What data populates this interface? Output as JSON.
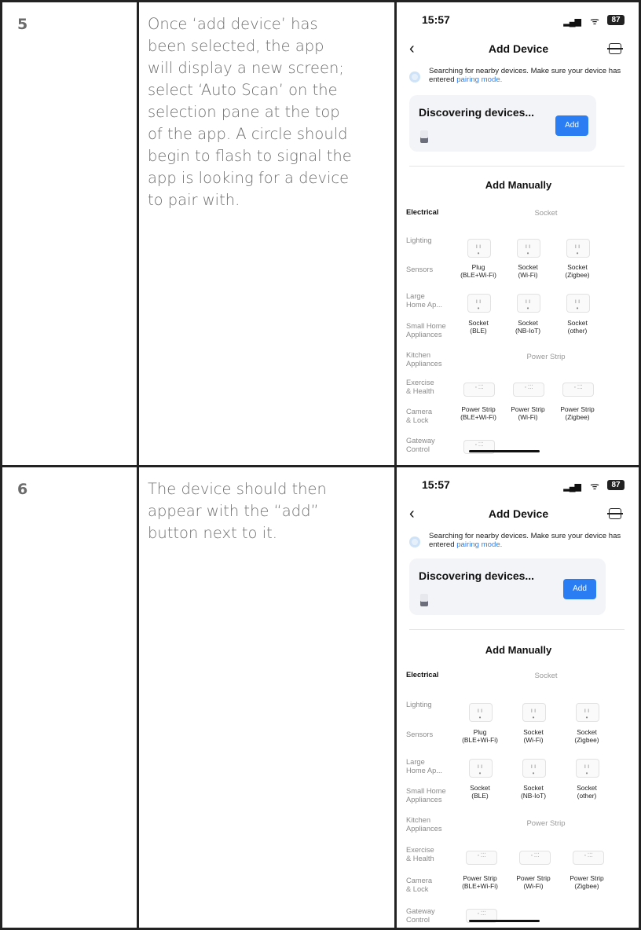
{
  "steps": [
    {
      "number": "5",
      "description": "Once ‘add device’ has\nbeen selected, the app\nwill display a new screen;\nselect ‘Auto Scan’ on the\nselection pane at the top\nof the app. A circle should\nbegin to flash to signal the\napp is looking for a device\nto pair with.",
      "phone": {
        "time": "15:57",
        "battery": "87",
        "nav_title": "Add Device",
        "search_text": "Searching for nearby devices. Make sure your device has entered ",
        "search_link": "pairing mode.",
        "card_title": "Discovering devices...",
        "add_label": "Add",
        "manual_title": "Add Manually",
        "categories": [
          "Electrical",
          "Lighting",
          "Sensors",
          "Large\nHome Ap...",
          "Small Home\nAppliances",
          "Kitchen\nAppliances",
          "Exercise\n& Health",
          "Camera\n& Lock",
          "Gateway\nControl"
        ],
        "section_socket": "Socket",
        "section_strip": "Power Strip",
        "sockets_row1": [
          "Plug\n(BLE+Wi-Fi)",
          "Socket\n(Wi-Fi)",
          "Socket\n(Zigbee)"
        ],
        "sockets_row2": [
          "Socket\n(BLE)",
          "Socket\n(NB-IoT)",
          "Socket\n(other)"
        ],
        "strips": [
          "Power Strip\n(BLE+Wi-Fi)",
          "Power Strip\n(Wi-Fi)",
          "Power Strip\n(Zigbee)"
        ]
      }
    },
    {
      "number": "6",
      "description": "The device should then\nappear with the “add”\nbutton next to it.",
      "phone": {
        "time": "15:57",
        "battery": "87",
        "nav_title": "Add Device",
        "search_text": "Searching for nearby devices. Make sure your device has entered ",
        "search_link": "pairing mode.",
        "card_title": "Discovering devices...",
        "add_label": "Add",
        "manual_title": "Add Manually",
        "categories": [
          "Electrical",
          "Lighting",
          "Sensors",
          "Large\nHome Ap...",
          "Small Home\nAppliances",
          "Kitchen\nAppliances",
          "Exercise\n& Health",
          "Camera\n& Lock",
          "Gateway\nControl"
        ],
        "section_socket": "Socket",
        "section_strip": "Power Strip",
        "sockets_row1": [
          "Plug\n(BLE+Wi-Fi)",
          "Socket\n(Wi-Fi)",
          "Socket\n(Zigbee)"
        ],
        "sockets_row2": [
          "Socket\n(BLE)",
          "Socket\n(NB-IoT)",
          "Socket\n(other)"
        ],
        "strips": [
          "Power Strip\n(BLE+Wi-Fi)",
          "Power Strip\n(Wi-Fi)",
          "Power Strip\n(Zigbee)"
        ]
      }
    }
  ]
}
